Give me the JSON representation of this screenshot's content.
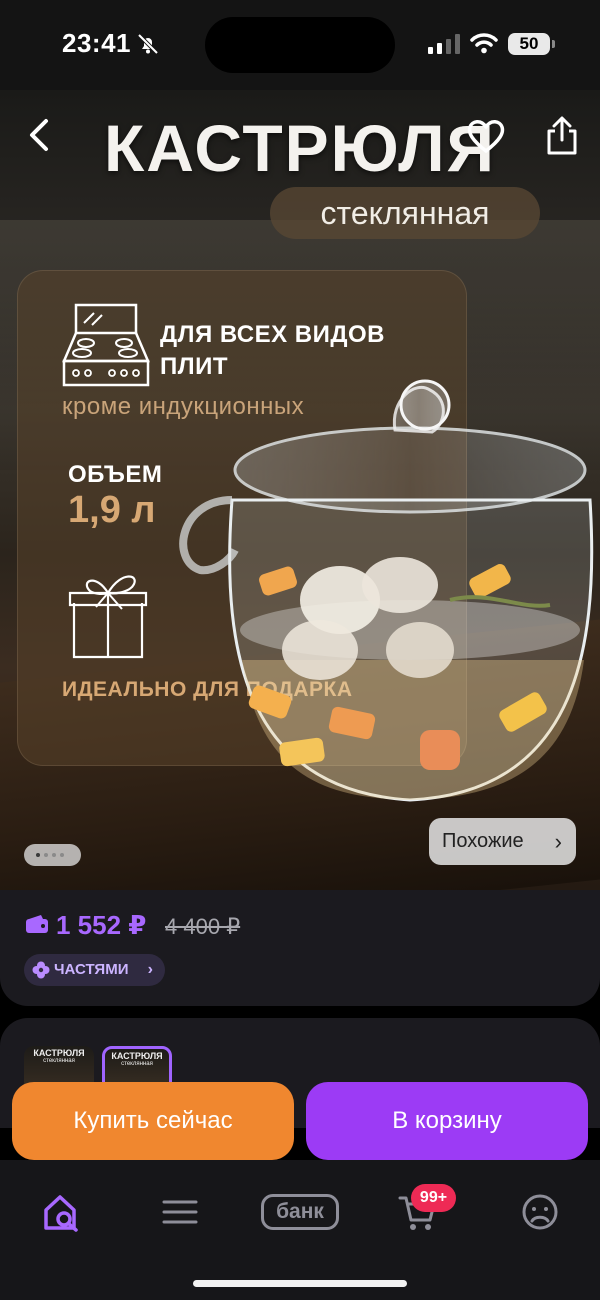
{
  "status_bar": {
    "time": "23:41",
    "battery": "50",
    "icons": [
      "bell-slash-icon",
      "signal-icon",
      "wifi-icon",
      "battery-icon"
    ]
  },
  "hero": {
    "title": "КАСТРЮЛЯ",
    "subtitle": "стеклянная",
    "features": {
      "plates": "ДЛЯ ВСЕХ ВИДОВ ПЛИТ",
      "plates_note": "кроме индукционных",
      "volume_label": "ОБЪЕМ",
      "volume_value": "1,9 л",
      "gift": "ИДЕАЛЬНО ДЛЯ ПОДАРКА"
    },
    "gallery_index": 1,
    "gallery_count": 4,
    "similar_label": "Похожие"
  },
  "price": {
    "current": "1 552 ₽",
    "old": "4 400 ₽",
    "installments_label": "ЧАСТЯМИ",
    "accent_color": "#a868ff"
  },
  "variants": [
    {
      "title": "КАСТРЮЛЯ",
      "subtitle": "стеклянная",
      "selected": false
    },
    {
      "title": "КАСТРЮЛЯ",
      "subtitle": "стеклянная",
      "selected": true
    }
  ],
  "actions": {
    "buy_now": "Купить сейчас",
    "to_cart": "В корзину",
    "buy_color": "#f0872f",
    "cart_color": "#9c3bf5"
  },
  "bottom_nav": {
    "bank_label": "банк",
    "cart_badge": "99+",
    "items": [
      "home-search-icon",
      "catalog-menu-icon",
      "bank-icon",
      "cart-icon",
      "profile-icon"
    ]
  }
}
